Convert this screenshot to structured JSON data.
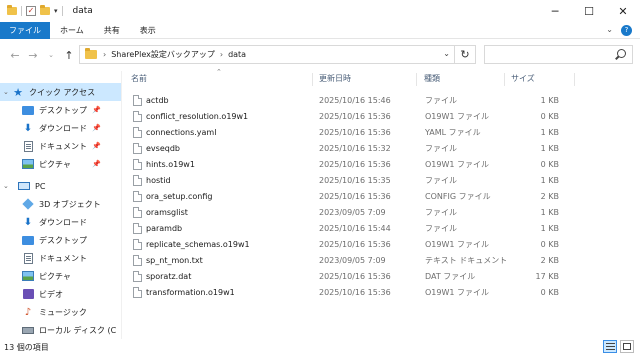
{
  "window": {
    "title": "data"
  },
  "ribbon": {
    "tabs": [
      "ファイル",
      "ホーム",
      "共有",
      "表示"
    ]
  },
  "address": {
    "segments": [
      "SharePlex設定バックアップ",
      "data"
    ],
    "search_placeholder": ""
  },
  "sidebar": {
    "items": [
      {
        "label": "クイック アクセス",
        "icon": "star-icon",
        "selected": true,
        "pinned": false
      },
      {
        "label": "デスクトップ",
        "icon": "desktop-icon",
        "pinned": true
      },
      {
        "label": "ダウンロード",
        "icon": "download-icon",
        "pinned": true
      },
      {
        "label": "ドキュメント",
        "icon": "document-icon",
        "pinned": true
      },
      {
        "label": "ピクチャ",
        "icon": "picture-icon",
        "pinned": true
      },
      {
        "label": "PC",
        "icon": "pc-icon",
        "pinned": false
      },
      {
        "label": "3D オブジェクト",
        "icon": "3d-objects-icon",
        "pinned": false
      },
      {
        "label": "ダウンロード",
        "icon": "download-icon",
        "pinned": false
      },
      {
        "label": "デスクトップ",
        "icon": "desktop-icon",
        "pinned": false
      },
      {
        "label": "ドキュメント",
        "icon": "document-icon",
        "pinned": false
      },
      {
        "label": "ピクチャ",
        "icon": "picture-icon",
        "pinned": false
      },
      {
        "label": "ビデオ",
        "icon": "video-icon",
        "pinned": false
      },
      {
        "label": "ミュージック",
        "icon": "music-icon",
        "pinned": false
      },
      {
        "label": "ローカル ディスク (C",
        "icon": "drive-icon",
        "pinned": false
      }
    ]
  },
  "columns": {
    "name": "名前",
    "date": "更新日時",
    "type": "種類",
    "size": "サイズ"
  },
  "files": [
    {
      "name": "actdb",
      "date": "2025/10/16 15:46",
      "type": "ファイル",
      "size": "1 KB"
    },
    {
      "name": "conflict_resolution.o19w1",
      "date": "2025/10/16 15:36",
      "type": "O19W1 ファイル",
      "size": "0 KB"
    },
    {
      "name": "connections.yaml",
      "date": "2025/10/16 15:36",
      "type": "YAML ファイル",
      "size": "1 KB"
    },
    {
      "name": "evseqdb",
      "date": "2025/10/16 15:32",
      "type": "ファイル",
      "size": "1 KB"
    },
    {
      "name": "hints.o19w1",
      "date": "2025/10/16 15:36",
      "type": "O19W1 ファイル",
      "size": "0 KB"
    },
    {
      "name": "hostid",
      "date": "2025/10/16 15:35",
      "type": "ファイル",
      "size": "1 KB"
    },
    {
      "name": "ora_setup.config",
      "date": "2025/10/16 15:36",
      "type": "CONFIG ファイル",
      "size": "2 KB"
    },
    {
      "name": "oramsglist",
      "date": "2023/09/05 7:09",
      "type": "ファイル",
      "size": "1 KB"
    },
    {
      "name": "paramdb",
      "date": "2025/10/16 15:44",
      "type": "ファイル",
      "size": "1 KB"
    },
    {
      "name": "replicate_schemas.o19w1",
      "date": "2025/10/16 15:36",
      "type": "O19W1 ファイル",
      "size": "0 KB"
    },
    {
      "name": "sp_nt_mon.txt",
      "date": "2023/09/05 7:09",
      "type": "テキスト ドキュメント",
      "size": "2 KB"
    },
    {
      "name": "sporatz.dat",
      "date": "2025/10/16 15:36",
      "type": "DAT ファイル",
      "size": "17 KB"
    },
    {
      "name": "transformation.o19w1",
      "date": "2025/10/16 15:36",
      "type": "O19W1 ファイル",
      "size": "0 KB"
    }
  ],
  "status": {
    "text": "13 個の項目"
  }
}
